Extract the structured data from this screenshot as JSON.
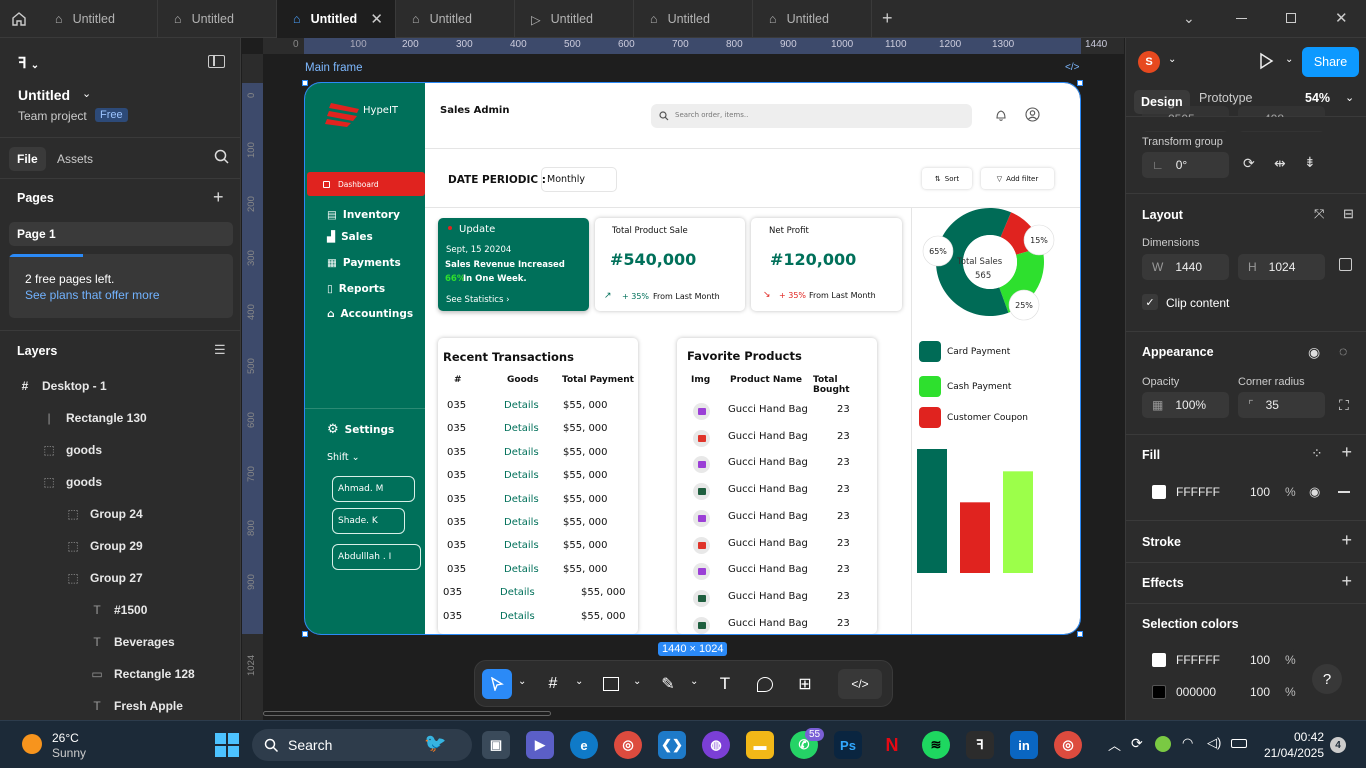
{
  "tabs": [
    "Untitled",
    "Untitled",
    "Untitled",
    "Untitled",
    "Untitled",
    "Untitled",
    "Untitled"
  ],
  "left_panel": {
    "file_name": "Untitled",
    "team": "Team project",
    "plan_badge": "Free",
    "file_tab": "File",
    "assets_tab": "Assets",
    "pages_label": "Pages",
    "page1": "Page 1",
    "free_pages": "2 free pages left.",
    "see_plans": "See plans that offer more",
    "layers_label": "Layers",
    "layers": [
      {
        "name": "Desktop - 1",
        "icon": "#"
      },
      {
        "name": "Rectangle 130",
        "icon": "|"
      },
      {
        "name": "goods",
        "icon": "⬚"
      },
      {
        "name": "goods",
        "icon": "⬚"
      },
      {
        "name": "Group 24",
        "icon": "⬚"
      },
      {
        "name": "Group 29",
        "icon": "⬚"
      },
      {
        "name": "Group 27",
        "icon": "⬚"
      },
      {
        "name": "#1500",
        "icon": "T"
      },
      {
        "name": "Beverages",
        "icon": "T"
      },
      {
        "name": "Rectangle 128",
        "icon": "▭"
      },
      {
        "name": "Fresh Apple",
        "icon": "T"
      }
    ]
  },
  "canvas": {
    "frame_label": "Main frame",
    "size_badge": "1440 × 1024",
    "ruler_top": [
      "0",
      "100",
      "200",
      "300",
      "400",
      "500",
      "600",
      "700",
      "800",
      "900",
      "1000",
      "1100",
      "1200",
      "1300",
      "1440"
    ],
    "ruler_left": [
      "0",
      "100",
      "200",
      "300",
      "400",
      "500",
      "600",
      "700",
      "800",
      "900",
      "1024"
    ]
  },
  "design": {
    "brand": "HypeIT",
    "page_title": "Sales Admin",
    "search_placeholder": "Search order, items..",
    "nav_active": "Dashboard",
    "nav": [
      "Inventory",
      "Sales",
      "Payments",
      "Reports",
      "Accountings"
    ],
    "settings": "Settings",
    "shift": "Shift",
    "staff": [
      "Ahmad. M",
      "Shade. K",
      "Abdulllah . I"
    ],
    "date_periodic": "DATE PERIODIC :",
    "period_value": "Monthly",
    "sort": "Sort",
    "add_filter": "Add filter",
    "update_card": {
      "title": "Update",
      "date": "Sept, 15 20204",
      "line1": "Sales Revenue Increased",
      "pct": "66%",
      "line2": " In One Week.",
      "link": "See Statistics  ›"
    },
    "kpi1": {
      "label": "Total Product Sale",
      "value": "#540,000",
      "change": "+ 35%",
      "suffix": "From Last Month"
    },
    "kpi2": {
      "label": "Net Profit",
      "value": "#120,000",
      "change": "+ 35%",
      "suffix": "From Last Month"
    },
    "recent": {
      "title": "Recent Transactions",
      "headers": [
        "#",
        "Goods",
        "Total Payment"
      ],
      "rows": [
        [
          "035",
          "Details",
          "$55, 000"
        ],
        [
          "035",
          "Details",
          "$55, 000"
        ],
        [
          "035",
          "Details",
          "$55, 000"
        ],
        [
          "035",
          "Details",
          "$55, 000"
        ],
        [
          "035",
          "Details",
          "$55, 000"
        ],
        [
          "035",
          "Details",
          "$55, 000"
        ],
        [
          "035",
          "Details",
          "$55, 000"
        ],
        [
          "035",
          "Details",
          "$55, 000"
        ],
        [
          "035",
          "Details",
          "$55, 000"
        ],
        [
          "035",
          "Details",
          "$55, 000"
        ]
      ]
    },
    "favorites": {
      "title": "Favorite Products",
      "headers": [
        "Img",
        "Product Name",
        "Total Bought"
      ],
      "rows": [
        {
          "name": "Gucci Hand Bag",
          "qty": "23",
          "color": "#9b3fd6"
        },
        {
          "name": "Gucci Hand Bag",
          "qty": "23",
          "color": "#e0342a"
        },
        {
          "name": "Gucci Hand Bag",
          "qty": "23",
          "color": "#9b3fd6"
        },
        {
          "name": "Gucci Hand Bag",
          "qty": "23",
          "color": "#1f5f3f"
        },
        {
          "name": "Gucci Hand Bag",
          "qty": "23",
          "color": "#9b3fd6"
        },
        {
          "name": "Gucci Hand Bag",
          "qty": "23",
          "color": "#e0342a"
        },
        {
          "name": "Gucci Hand Bag",
          "qty": "23",
          "color": "#9b3fd6"
        },
        {
          "name": "Gucci Hand Bag",
          "qty": "23",
          "color": "#1f5f3f"
        },
        {
          "name": "Gucci Hand Bag",
          "qty": "23",
          "color": "#1f5f3f"
        }
      ]
    },
    "donut": {
      "center_label": "Total Sales",
      "center_value": "565",
      "labels": [
        "65%",
        "15%",
        "25%"
      ]
    },
    "legend": [
      {
        "label": "Card Payment",
        "color": "#006b56"
      },
      {
        "label": "Cash Payment",
        "color": "#2ee02e"
      },
      {
        "label": "Customer Coupon",
        "color": "#e0231f"
      }
    ]
  },
  "chart_data": [
    {
      "type": "pie",
      "title": "",
      "center_text": "Total Sales 565",
      "slices": [
        {
          "label": "65%",
          "value": 65
        },
        {
          "label": "15%",
          "value": 15
        },
        {
          "label": "25%",
          "value": 25
        }
      ]
    },
    {
      "type": "bar",
      "title": "",
      "categories": [
        "Card Payment",
        "Cash Payment",
        "Customer Coupon"
      ],
      "values": [
        100,
        57,
        82
      ],
      "colors": [
        "#006b56",
        "#e0231f",
        "#9cff4a"
      ]
    }
  ],
  "right_panel": {
    "avatar_letter": "S",
    "share": "Share",
    "design_tab": "Design",
    "prototype_tab": "Prototype",
    "zoom": "54%",
    "partial_x": "2505",
    "partial_y": "408",
    "transform_group": "Transform group",
    "rotation": "0°",
    "layout": "Layout",
    "dimensions": "Dimensions",
    "w_label": "W",
    "w": "1440",
    "h_label": "H",
    "h": "1024",
    "clip": "Clip content",
    "appearance": "Appearance",
    "opacity_label": "Opacity",
    "opacity": "100%",
    "radius_label": "Corner radius",
    "radius": "35",
    "fill": "Fill",
    "fill_hex": "FFFFFF",
    "fill_pct": "100",
    "pct": "%",
    "stroke": "Stroke",
    "effects": "Effects",
    "selection_colors": "Selection colors",
    "sel1_hex": "FFFFFF",
    "sel1_pct": "100",
    "sel2_hex": "000000",
    "sel2_pct": "100",
    "help": "?"
  },
  "taskbar": {
    "temp": "26°C",
    "weather": "Sunny",
    "search": "Search",
    "time": "00:42",
    "date": "21/04/2025",
    "wa_badge": "55",
    "notif": "4"
  }
}
